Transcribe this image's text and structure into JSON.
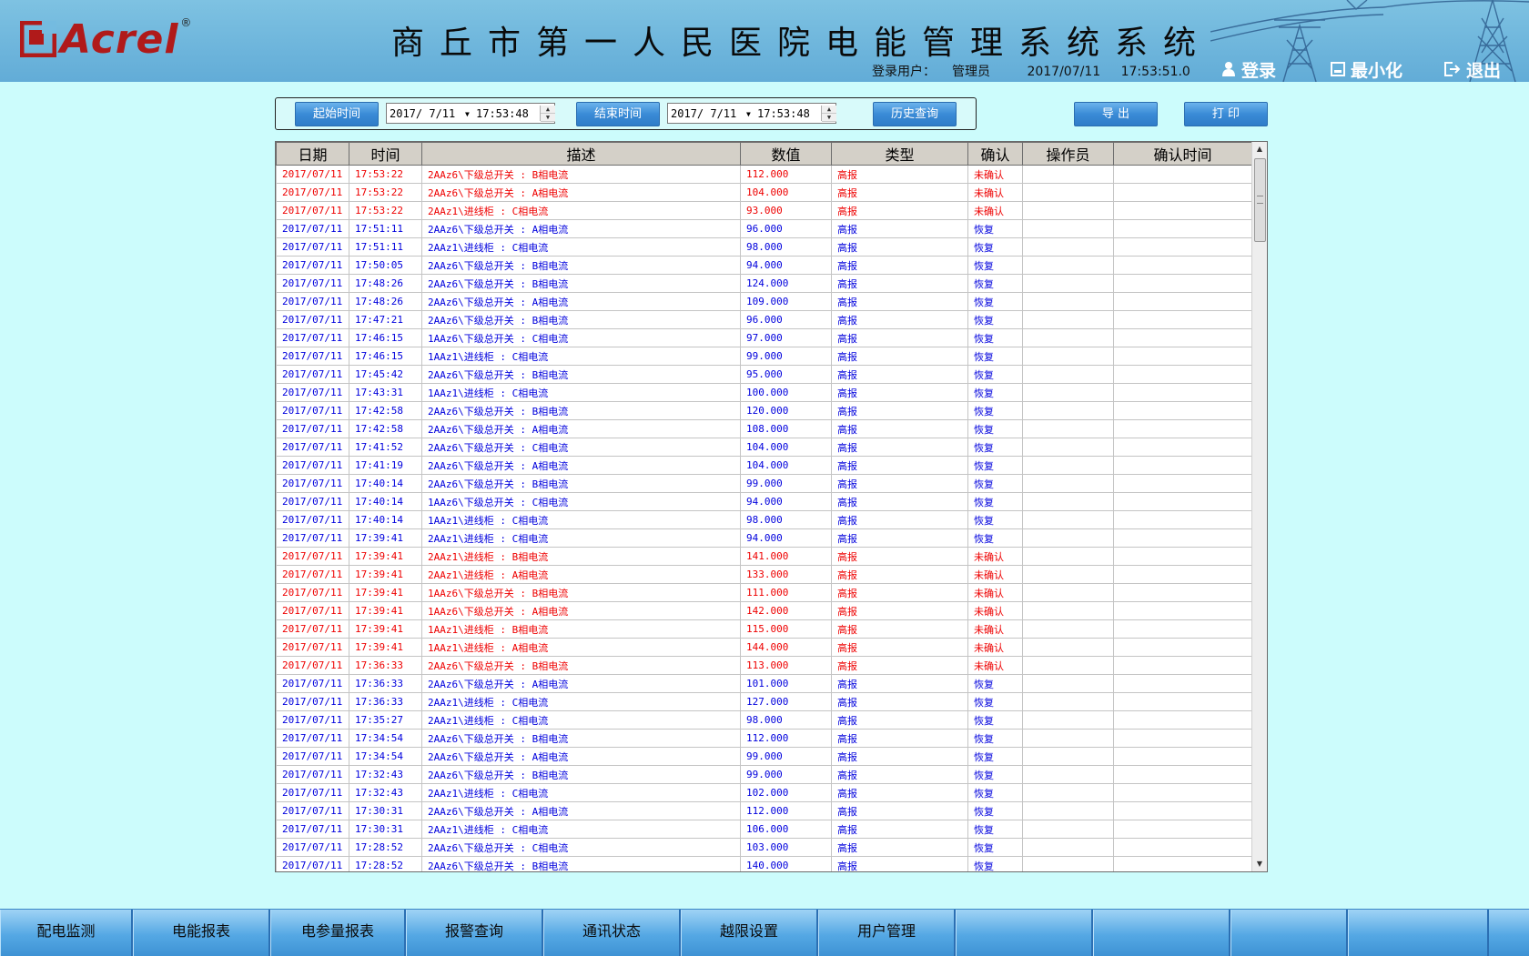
{
  "header": {
    "logo_text": "Acrel",
    "logo_reg": "®",
    "title": "商丘市第一人民医院电能管理系统系统",
    "login_user_label": "登录用户：",
    "login_user": "管理员",
    "date": "2017/07/11",
    "time": "17:53:51.0",
    "buttons": {
      "login": "登录",
      "minimize": "最小化",
      "exit": "退出"
    }
  },
  "query": {
    "start_label": "起始时间",
    "start_date": "2017/ 7/11",
    "start_time": "17:53:48",
    "end_label": "结束时间",
    "end_date": "2017/ 7/11",
    "end_time": "17:53:48",
    "history_label": "历史查询",
    "export_label": "导 出",
    "print_label": "打 印"
  },
  "table": {
    "columns": [
      "日期",
      "时间",
      "描述",
      "数值",
      "类型",
      "确认",
      "操作员",
      "确认时间"
    ],
    "rows": [
      [
        "2017/07/11",
        "17:53:22",
        "2AAz6\\下级总开关 : B相电流",
        "112.000",
        "高报",
        "未确认",
        "",
        ""
      ],
      [
        "2017/07/11",
        "17:53:22",
        "2AAz6\\下级总开关 : A相电流",
        "104.000",
        "高报",
        "未确认",
        "",
        ""
      ],
      [
        "2017/07/11",
        "17:53:22",
        "2AAz1\\进线柜 : C相电流",
        "93.000",
        "高报",
        "未确认",
        "",
        ""
      ],
      [
        "2017/07/11",
        "17:51:11",
        "2AAz6\\下级总开关 : A相电流",
        "96.000",
        "高报",
        "恢复",
        "",
        ""
      ],
      [
        "2017/07/11",
        "17:51:11",
        "2AAz1\\进线柜 : C相电流",
        "98.000",
        "高报",
        "恢复",
        "",
        ""
      ],
      [
        "2017/07/11",
        "17:50:05",
        "2AAz6\\下级总开关 : B相电流",
        "94.000",
        "高报",
        "恢复",
        "",
        ""
      ],
      [
        "2017/07/11",
        "17:48:26",
        "2AAz6\\下级总开关 : B相电流",
        "124.000",
        "高报",
        "恢复",
        "",
        ""
      ],
      [
        "2017/07/11",
        "17:48:26",
        "2AAz6\\下级总开关 : A相电流",
        "109.000",
        "高报",
        "恢复",
        "",
        ""
      ],
      [
        "2017/07/11",
        "17:47:21",
        "2AAz6\\下级总开关 : B相电流",
        "96.000",
        "高报",
        "恢复",
        "",
        ""
      ],
      [
        "2017/07/11",
        "17:46:15",
        "1AAz6\\下级总开关 : C相电流",
        "97.000",
        "高报",
        "恢复",
        "",
        ""
      ],
      [
        "2017/07/11",
        "17:46:15",
        "1AAz1\\进线柜 : C相电流",
        "99.000",
        "高报",
        "恢复",
        "",
        ""
      ],
      [
        "2017/07/11",
        "17:45:42",
        "2AAz6\\下级总开关 : B相电流",
        "95.000",
        "高报",
        "恢复",
        "",
        ""
      ],
      [
        "2017/07/11",
        "17:43:31",
        "1AAz1\\进线柜 : C相电流",
        "100.000",
        "高报",
        "恢复",
        "",
        ""
      ],
      [
        "2017/07/11",
        "17:42:58",
        "2AAz6\\下级总开关 : B相电流",
        "120.000",
        "高报",
        "恢复",
        "",
        ""
      ],
      [
        "2017/07/11",
        "17:42:58",
        "2AAz6\\下级总开关 : A相电流",
        "108.000",
        "高报",
        "恢复",
        "",
        ""
      ],
      [
        "2017/07/11",
        "17:41:52",
        "2AAz6\\下级总开关 : C相电流",
        "104.000",
        "高报",
        "恢复",
        "",
        ""
      ],
      [
        "2017/07/11",
        "17:41:19",
        "2AAz6\\下级总开关 : A相电流",
        "104.000",
        "高报",
        "恢复",
        "",
        ""
      ],
      [
        "2017/07/11",
        "17:40:14",
        "2AAz6\\下级总开关 : B相电流",
        "99.000",
        "高报",
        "恢复",
        "",
        ""
      ],
      [
        "2017/07/11",
        "17:40:14",
        "1AAz6\\下级总开关 : C相电流",
        "94.000",
        "高报",
        "恢复",
        "",
        ""
      ],
      [
        "2017/07/11",
        "17:40:14",
        "1AAz1\\进线柜 : C相电流",
        "98.000",
        "高报",
        "恢复",
        "",
        ""
      ],
      [
        "2017/07/11",
        "17:39:41",
        "2AAz1\\进线柜 : C相电流",
        "94.000",
        "高报",
        "恢复",
        "",
        ""
      ],
      [
        "2017/07/11",
        "17:39:41",
        "2AAz1\\进线柜 : B相电流",
        "141.000",
        "高报",
        "未确认",
        "",
        ""
      ],
      [
        "2017/07/11",
        "17:39:41",
        "2AAz1\\进线柜 : A相电流",
        "133.000",
        "高报",
        "未确认",
        "",
        ""
      ],
      [
        "2017/07/11",
        "17:39:41",
        "1AAz6\\下级总开关 : B相电流",
        "111.000",
        "高报",
        "未确认",
        "",
        ""
      ],
      [
        "2017/07/11",
        "17:39:41",
        "1AAz6\\下级总开关 : A相电流",
        "142.000",
        "高报",
        "未确认",
        "",
        ""
      ],
      [
        "2017/07/11",
        "17:39:41",
        "1AAz1\\进线柜 : B相电流",
        "115.000",
        "高报",
        "未确认",
        "",
        ""
      ],
      [
        "2017/07/11",
        "17:39:41",
        "1AAz1\\进线柜 : A相电流",
        "144.000",
        "高报",
        "未确认",
        "",
        ""
      ],
      [
        "2017/07/11",
        "17:36:33",
        "2AAz6\\下级总开关 : B相电流",
        "113.000",
        "高报",
        "未确认",
        "",
        ""
      ],
      [
        "2017/07/11",
        "17:36:33",
        "2AAz6\\下级总开关 : A相电流",
        "101.000",
        "高报",
        "恢复",
        "",
        ""
      ],
      [
        "2017/07/11",
        "17:36:33",
        "2AAz1\\进线柜 : C相电流",
        "127.000",
        "高报",
        "恢复",
        "",
        ""
      ],
      [
        "2017/07/11",
        "17:35:27",
        "2AAz1\\进线柜 : C相电流",
        "98.000",
        "高报",
        "恢复",
        "",
        ""
      ],
      [
        "2017/07/11",
        "17:34:54",
        "2AAz6\\下级总开关 : B相电流",
        "112.000",
        "高报",
        "恢复",
        "",
        ""
      ],
      [
        "2017/07/11",
        "17:34:54",
        "2AAz6\\下级总开关 : A相电流",
        "99.000",
        "高报",
        "恢复",
        "",
        ""
      ],
      [
        "2017/07/11",
        "17:32:43",
        "2AAz6\\下级总开关 : B相电流",
        "99.000",
        "高报",
        "恢复",
        "",
        ""
      ],
      [
        "2017/07/11",
        "17:32:43",
        "2AAz1\\进线柜 : C相电流",
        "102.000",
        "高报",
        "恢复",
        "",
        ""
      ],
      [
        "2017/07/11",
        "17:30:31",
        "2AAz6\\下级总开关 : A相电流",
        "112.000",
        "高报",
        "恢复",
        "",
        ""
      ],
      [
        "2017/07/11",
        "17:30:31",
        "2AAz1\\进线柜 : C相电流",
        "106.000",
        "高报",
        "恢复",
        "",
        ""
      ],
      [
        "2017/07/11",
        "17:28:52",
        "2AAz6\\下级总开关 : C相电流",
        "103.000",
        "高报",
        "恢复",
        "",
        ""
      ],
      [
        "2017/07/11",
        "17:28:52",
        "2AAz6\\下级总开关 : B相电流",
        "140.000",
        "高报",
        "恢复",
        "",
        ""
      ]
    ]
  },
  "colors": {
    "unconfirmed": "#ee0000",
    "restored": "#0000dd"
  },
  "nav": [
    "配电监测",
    "电能报表",
    "电参量报表",
    "报警查询",
    "通讯状态",
    "越限设置",
    "用户管理",
    "",
    "",
    "",
    ""
  ]
}
